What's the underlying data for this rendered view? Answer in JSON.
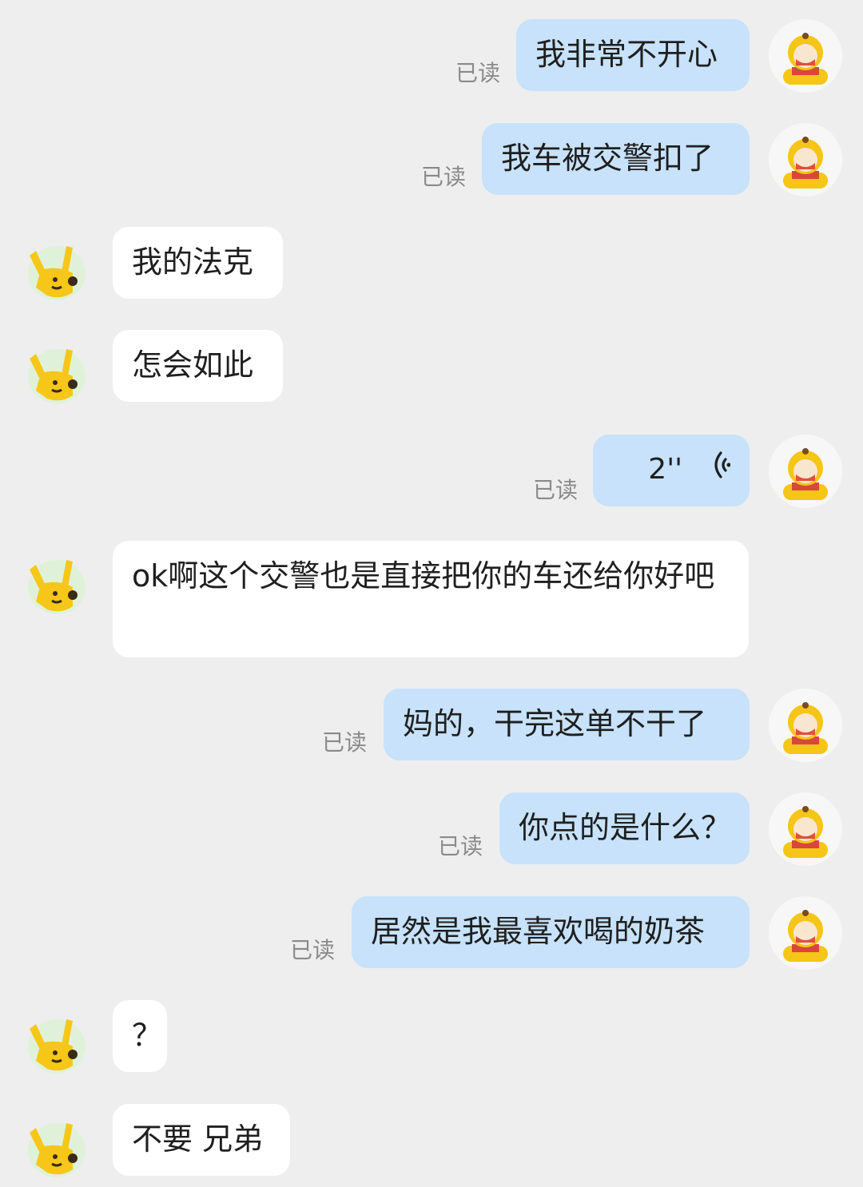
{
  "chat": {
    "read_label": "已读",
    "messages": [
      {
        "side": "out",
        "text": "我非常不开心"
      },
      {
        "side": "out",
        "text": "我车被交警扣了"
      },
      {
        "side": "in",
        "text": "我的法克"
      },
      {
        "side": "in",
        "text": "怎会如此"
      },
      {
        "side": "out",
        "type": "voice",
        "duration": "2''"
      },
      {
        "side": "in",
        "text": "ok啊这个交警也是直接把你的车还给你好吧"
      },
      {
        "side": "out",
        "text": "妈的，干完这单不干了"
      },
      {
        "side": "out",
        "text": "你点的是什么？"
      },
      {
        "side": "out",
        "text": "居然是我最喜欢喝的奶茶"
      },
      {
        "side": "in",
        "text": "？"
      },
      {
        "side": "in",
        "text": "不要 兄弟"
      }
    ]
  },
  "colors": {
    "background": "#eeeeee",
    "outgoing_bubble": "#c7e2fa",
    "incoming_bubble": "#ffffff",
    "read_text": "#8a8a8a",
    "avatar_yellow": "#f5c518"
  },
  "icons": {
    "me_avatar": "cartoon-character-avatar-icon",
    "friend_avatar": "yellow-hand-avatar-icon",
    "voice": "voice-wave-icon"
  }
}
